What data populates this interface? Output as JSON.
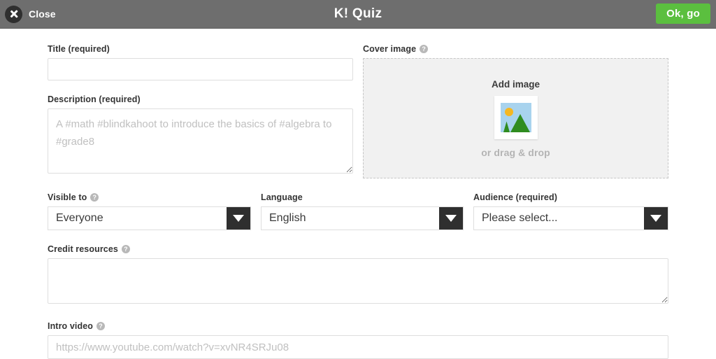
{
  "header": {
    "close_label": "Close",
    "close_icon": "close-x-icon",
    "title": "K! Quiz",
    "primary_button": "Ok, go",
    "background_color": "#6e6e6e",
    "primary_button_color": "#5bbf3f"
  },
  "form": {
    "title_field": {
      "label": "Title (required)",
      "value": "",
      "placeholder": ""
    },
    "description_field": {
      "label": "Description (required)",
      "value": "",
      "placeholder": "A #math #blindkahoot to introduce the basics of #algebra to #grade8"
    },
    "cover_image": {
      "label": "Cover image",
      "help_icon": "help-question-icon",
      "add_label": "Add image",
      "drag_label": "or drag & drop",
      "thumbnail_icon": "image-placeholder-icon",
      "thumbnail_colors": {
        "sky": "#a8d3ee",
        "sun": "#f5b722",
        "mountain": "#2f8c1f",
        "card": "#ffffff"
      }
    },
    "visible_to": {
      "label": "Visible to",
      "help_icon": "help-question-icon",
      "value": "Everyone",
      "options": [
        "Everyone"
      ]
    },
    "language": {
      "label": "Language",
      "value": "English",
      "options": [
        "English"
      ]
    },
    "audience": {
      "label": "Audience (required)",
      "value": "Please select...",
      "options": [
        "Please select..."
      ]
    },
    "credit_resources": {
      "label": "Credit resources",
      "help_icon": "help-question-icon",
      "value": "",
      "placeholder": ""
    },
    "intro_video": {
      "label": "Intro video",
      "help_icon": "help-question-icon",
      "value": "",
      "placeholder": "https://www.youtube.com/watch?v=xvNR4SRJu08"
    }
  },
  "icons": {
    "help_glyph": "?",
    "dropdown_glyph": "▼"
  }
}
